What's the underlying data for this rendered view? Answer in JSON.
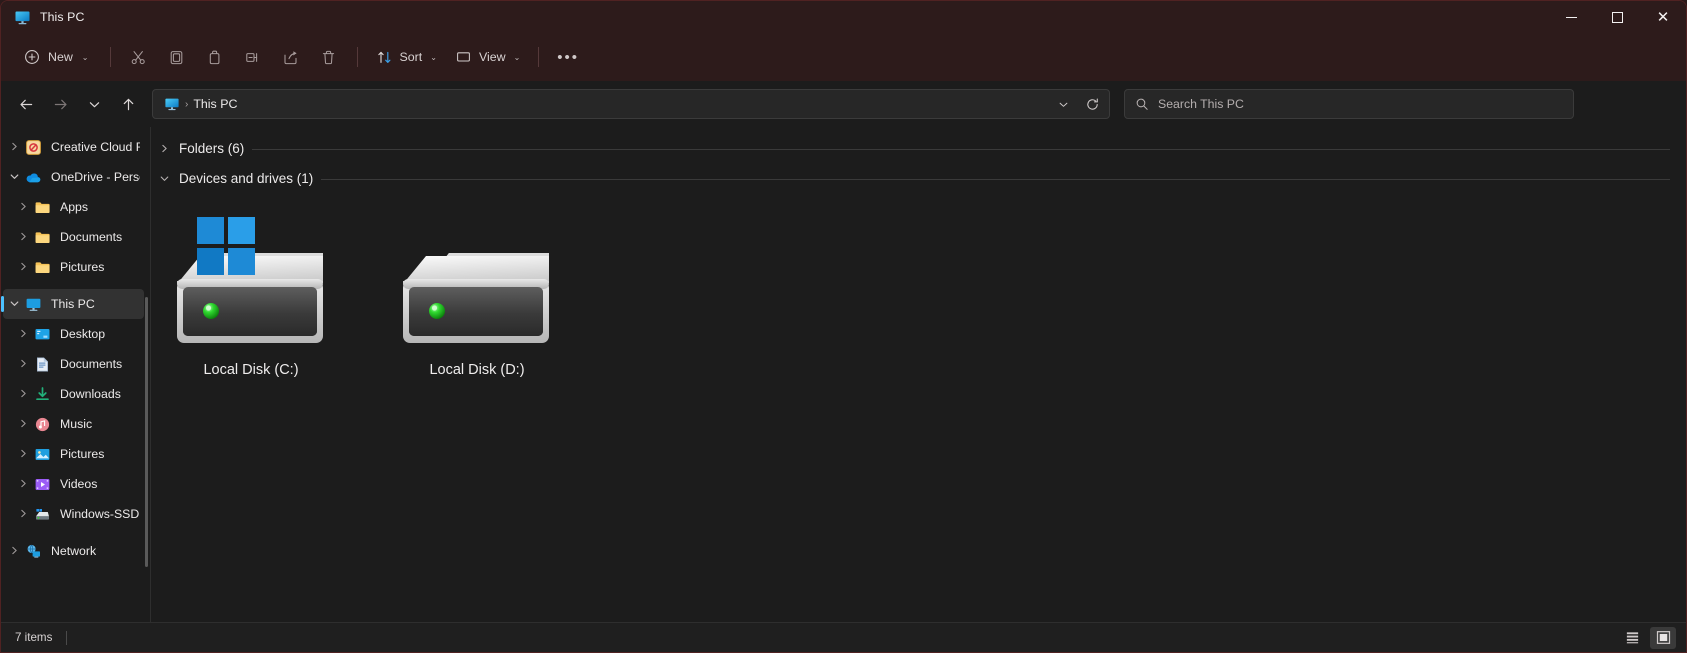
{
  "window": {
    "title": "This PC",
    "title_icon": "this-pc-icon",
    "controls": {
      "minimize": "—",
      "maximize": "□",
      "close": "✕"
    }
  },
  "toolbar": {
    "new_label": "New",
    "new_icon": "plus-circle-icon",
    "cut_icon": "scissors-icon",
    "copy_icon": "copy-icon",
    "paste_icon": "paste-icon",
    "rename_icon": "rename-icon",
    "share_icon": "share-icon",
    "delete_icon": "trash-icon",
    "sort_label": "Sort",
    "sort_icon": "sort-arrows-icon",
    "view_label": "View",
    "view_icon": "view-monitor-icon",
    "more_label": "•••",
    "chevron": "⌄"
  },
  "navigation": {
    "back_icon": "arrow-left-icon",
    "forward_icon": "arrow-right-icon",
    "recent_icon": "chevron-down-icon",
    "up_icon": "arrow-up-icon",
    "breadcrumb": {
      "icon": "this-pc-icon",
      "separator": "›",
      "path": "This PC"
    },
    "dropdown_icon": "chevron-down-icon",
    "refresh_icon": "refresh-icon"
  },
  "search": {
    "icon": "search-icon",
    "placeholder": "Search This PC",
    "value": ""
  },
  "sidebar": {
    "items": [
      {
        "label": "Creative Cloud Fi",
        "icon": "creative-cloud-icon",
        "level": 1,
        "expanded": false,
        "selected": false
      },
      {
        "label": "OneDrive - Perso",
        "icon": "onedrive-icon",
        "level": 1,
        "expanded": true,
        "selected": false
      },
      {
        "label": "Apps",
        "icon": "folder-icon",
        "level": 2,
        "expanded": false,
        "selected": false
      },
      {
        "label": "Documents",
        "icon": "folder-icon",
        "level": 2,
        "expanded": false,
        "selected": false
      },
      {
        "label": "Pictures",
        "icon": "folder-icon",
        "level": 2,
        "expanded": false,
        "selected": false
      },
      {
        "label": "This PC",
        "icon": "this-pc-icon",
        "level": 1,
        "expanded": true,
        "selected": true
      },
      {
        "label": "Desktop",
        "icon": "desktop-icon",
        "level": 2,
        "expanded": false,
        "selected": false
      },
      {
        "label": "Documents",
        "icon": "documents-icon",
        "level": 2,
        "expanded": false,
        "selected": false
      },
      {
        "label": "Downloads",
        "icon": "downloads-icon",
        "level": 2,
        "expanded": false,
        "selected": false
      },
      {
        "label": "Music",
        "icon": "music-icon",
        "level": 2,
        "expanded": false,
        "selected": false
      },
      {
        "label": "Pictures",
        "icon": "pictures-icon",
        "level": 2,
        "expanded": false,
        "selected": false
      },
      {
        "label": "Videos",
        "icon": "videos-icon",
        "level": 2,
        "expanded": false,
        "selected": false
      },
      {
        "label": "Windows-SSD (",
        "icon": "drive-icon",
        "level": 2,
        "expanded": false,
        "selected": false
      },
      {
        "label": "Network",
        "icon": "network-icon",
        "level": 1,
        "expanded": false,
        "selected": false
      }
    ]
  },
  "content": {
    "groups": [
      {
        "label": "Folders (6)",
        "expanded": false
      },
      {
        "label": "Devices and drives (1)",
        "expanded": true
      }
    ],
    "drives": [
      {
        "label": "Local Disk (C:)",
        "icon": "hard-drive-icon",
        "system": true,
        "led": "#2fd92f"
      },
      {
        "label": "Local Disk (D:)",
        "icon": "hard-drive-icon",
        "system": false,
        "led": "#2fd92f"
      }
    ]
  },
  "statusbar": {
    "item_count": "7 items",
    "details_view_icon": "list-details-icon",
    "large_icons_view_icon": "large-icons-icon",
    "active_view": "large-icons"
  },
  "colors": {
    "accent": "#4cc2ff",
    "titlebar_bg": "#2d1b1b",
    "window_bg": "#1c1c1c",
    "selection_bg": "#323232",
    "led_green": "#2fd92f"
  }
}
